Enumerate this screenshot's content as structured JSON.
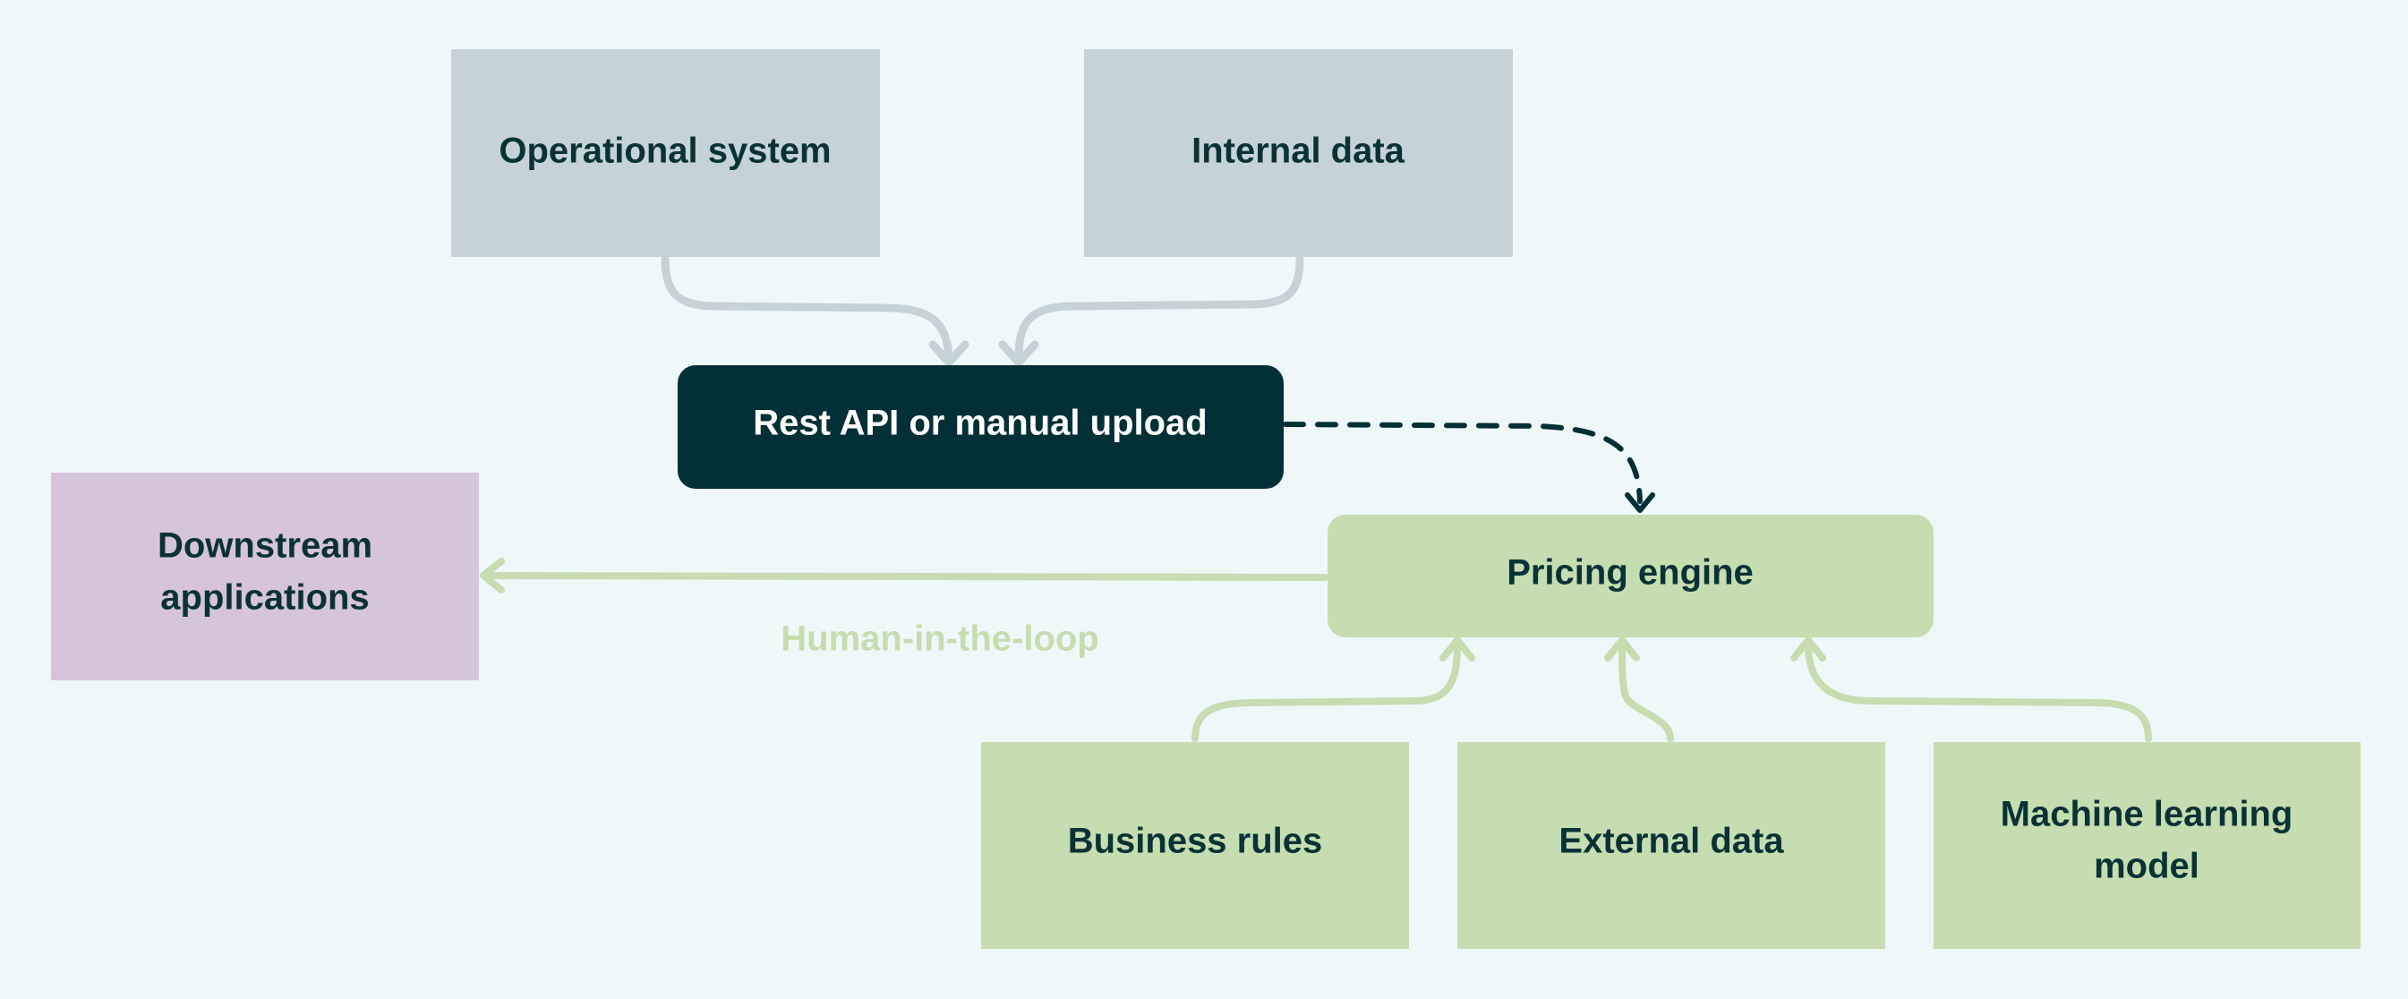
{
  "colors": {
    "background": "#eff8f9",
    "gray_box": "#c5d2d8",
    "dark_box": "#033036",
    "green_box": "#c5ddb0",
    "purple_box": "#d6c4dc",
    "text_dark": "#0a3236"
  },
  "nodes": {
    "operational": "Operational system",
    "internal": "Internal data",
    "rest_api": "Rest API or manual upload",
    "downstream_1": "Downstream",
    "downstream_2": "applications",
    "pricing": "Pricing engine",
    "business_rules": "Business rules",
    "external": "External data",
    "ml_1": "Machine learning",
    "ml_2": "model"
  },
  "edges": {
    "human_label": "Human-in-the-loop"
  }
}
